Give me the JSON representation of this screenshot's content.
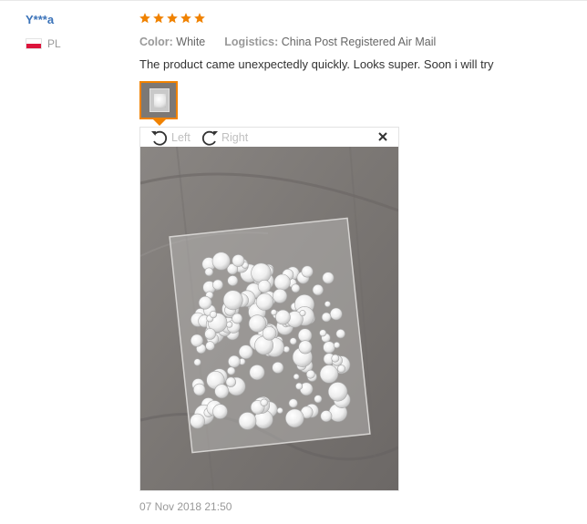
{
  "reviewer": {
    "name": "Y***a",
    "country_code": "PL"
  },
  "rating": {
    "stars": 5,
    "max": 5,
    "color": "#f08200"
  },
  "attributes": {
    "color_label": "Color:",
    "color_value": "White",
    "logistics_label": "Logistics:",
    "logistics_value": "China Post Registered Air Mail"
  },
  "review_text": "The product came unexpectedly quickly. Looks super. Soon i will try",
  "thumbnail": {
    "selected": true
  },
  "viewer": {
    "rotate_left_label": "Left",
    "rotate_right_label": "Right",
    "rotate_left_icon": "rotate-left-icon",
    "rotate_right_icon": "rotate-right-icon",
    "close_icon": "close-icon"
  },
  "date": "07 Nov 2018 21:50",
  "colors": {
    "username": "#3b73b9",
    "accent": "#f08200",
    "muted": "#999999"
  }
}
